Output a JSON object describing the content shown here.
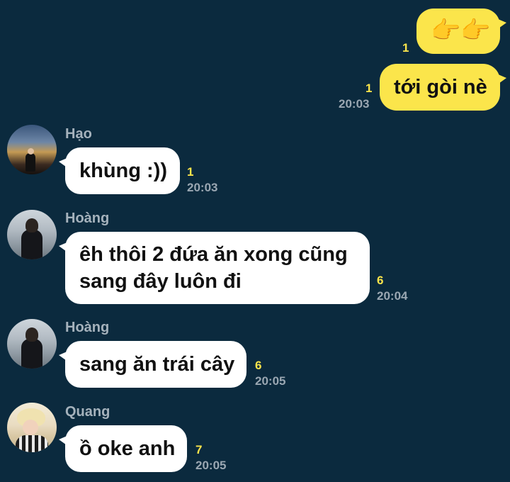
{
  "messages": [
    {
      "type": "outgoing",
      "text": "👉👉",
      "unread": "1",
      "time": ""
    },
    {
      "type": "outgoing",
      "text": "tới gòi nè",
      "unread": "1",
      "time": "20:03"
    },
    {
      "type": "incoming",
      "sender": "Hạo",
      "text": "khùng :))",
      "unread": "1",
      "time": "20:03"
    },
    {
      "type": "incoming",
      "sender": "Hoàng",
      "text": "êh thôi 2 đứa ăn xong cũng\nsang đây luôn đi",
      "unread": "6",
      "time": "20:04"
    },
    {
      "type": "incoming",
      "sender": "Hoàng",
      "text": "sang ăn trái cây",
      "unread": "6",
      "time": "20:05"
    },
    {
      "type": "incoming",
      "sender": "Quang",
      "text": "ồ oke anh",
      "unread": "7",
      "time": "20:05"
    }
  ],
  "colors": {
    "background": "#0b2a3e",
    "outgoing_bubble": "#fbe54b",
    "incoming_bubble": "#ffffff",
    "unread_count": "#fbe54b",
    "timestamp": "#9aa7b2",
    "sender_name": "#a5b2bc"
  },
  "icons": [
    "pointing-right-emoji",
    "avatar-hao",
    "avatar-hoang",
    "avatar-quang"
  ]
}
